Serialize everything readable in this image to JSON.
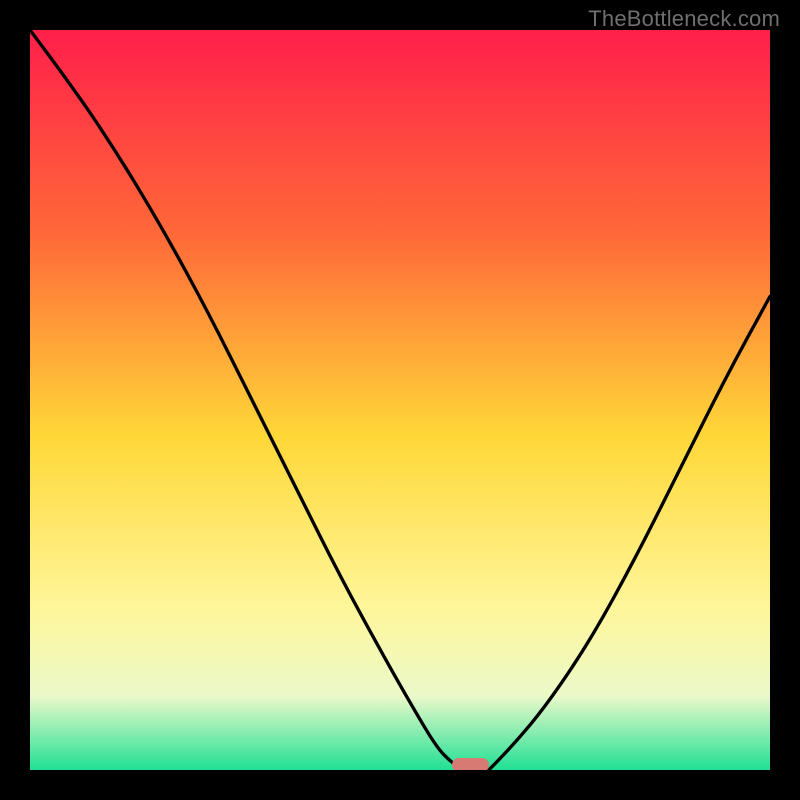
{
  "watermark": "TheBottleneck.com",
  "colors": {
    "frame": "#000000",
    "gradient_top": "#ff1f4a",
    "gradient_mid_upper": "#ff6a38",
    "gradient_mid": "#ffd838",
    "gradient_mid_lower": "#fff69a",
    "gradient_lower": "#ebf9c9",
    "gradient_bottom": "#20e095",
    "curve": "#000000",
    "marker": "#d77a74"
  },
  "chart_data": {
    "type": "line",
    "title": "",
    "xlabel": "",
    "ylabel": "",
    "xlim": [
      0,
      100
    ],
    "ylim": [
      0,
      100
    ],
    "series": [
      {
        "name": "bottleneck-curve-left",
        "x": [
          0,
          6,
          12,
          18,
          24,
          30,
          36,
          42,
          48,
          52,
          55,
          57,
          58.5
        ],
        "values": [
          100,
          92,
          83,
          73,
          62,
          50,
          38,
          26,
          15,
          8,
          3,
          1,
          0
        ]
      },
      {
        "name": "bottleneck-curve-right",
        "x": [
          62,
          65,
          70,
          76,
          82,
          88,
          94,
          100
        ],
        "values": [
          0,
          3,
          9,
          18,
          29,
          41,
          53,
          64
        ]
      }
    ],
    "minimum_marker": {
      "x_start": 57,
      "x_end": 62,
      "y": 0
    },
    "gradient_stops": [
      {
        "pct": 0,
        "color": "#ff1f4a"
      },
      {
        "pct": 28,
        "color": "#ff6a38"
      },
      {
        "pct": 55,
        "color": "#ffd838"
      },
      {
        "pct": 78,
        "color": "#fff69a"
      },
      {
        "pct": 90,
        "color": "#ebf9c9"
      },
      {
        "pct": 100,
        "color": "#20e095"
      }
    ]
  }
}
